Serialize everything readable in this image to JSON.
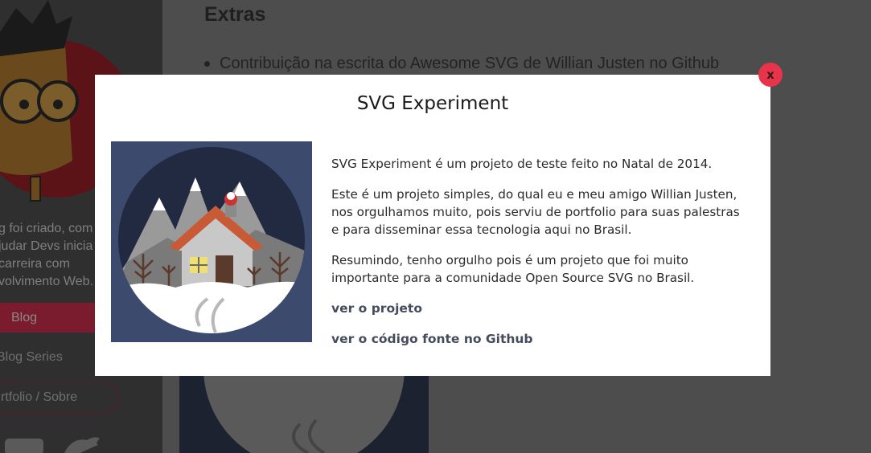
{
  "sidebar": {
    "intro_lines": [
      "g foi criado, com o",
      "judar Devs inicia",
      "carreira com",
      "volvimento Web."
    ],
    "nav": {
      "blog": "Blog",
      "series": "Blog Series",
      "portfolio": "rtfolio / Sobre"
    },
    "social_icons": [
      "youtube-icon",
      "twitter-icon"
    ]
  },
  "main": {
    "heading": "Extras",
    "bullet": "Contribuição na escrita do Awesome SVG de Willian Justen no Github"
  },
  "modal": {
    "title": "SVG Experiment",
    "paragraphs": [
      "SVG Experiment é um projeto de teste feito no Natal de 2014.",
      "Este é um projeto simples, do qual eu e meu amigo Willian Justen, nos orgulhamos muito, pois serviu de portfolio para suas palestras e para disseminar essa tecnologia aqui no Brasil.",
      "Resumindo, tenho orgulho pois é um projeto que foi muito importante para a comunidade Open Source SVG no Brasil."
    ],
    "links": {
      "project": "ver o projeto",
      "source": "ver o código fonte no Github"
    },
    "close_label": "x"
  },
  "colors": {
    "accent": "#e8344a",
    "link": "#444b5c",
    "overlay": "#4d4d4d"
  }
}
